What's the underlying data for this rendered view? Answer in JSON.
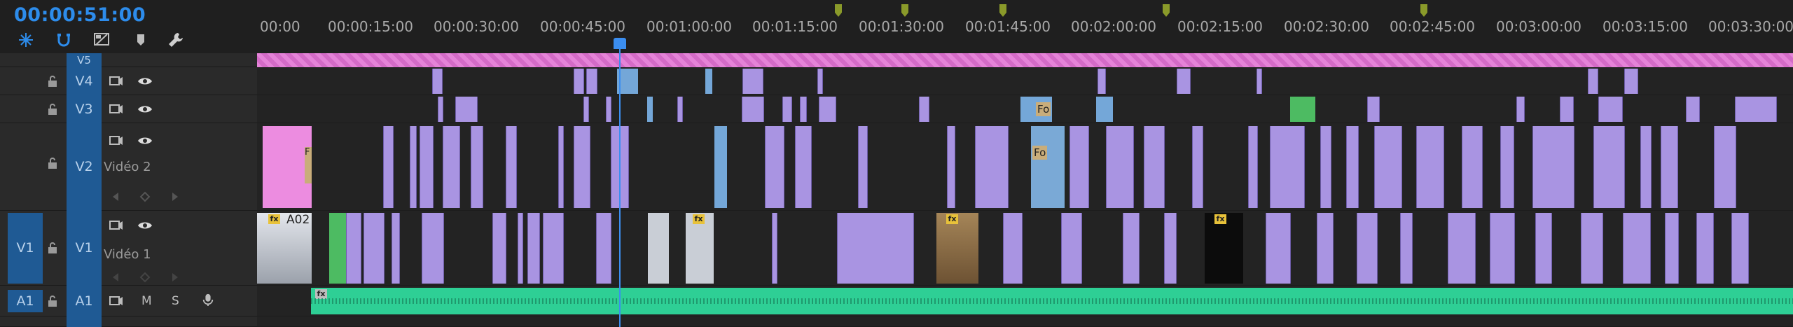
{
  "timecode": "00:00:51:00",
  "ruler": {
    "labels": [
      "00:00",
      "00:00:15:00",
      "00:00:30:00",
      "00:00:45:00",
      "00:01:00:00",
      "00:01:15:00",
      "00:01:30:00",
      "00:01:45:00",
      "00:02:00:00",
      "00:02:15:00",
      "00:02:30:00",
      "00:02:45:00",
      "00:03:00:00",
      "00:03:15:00",
      "00:03:30:00"
    ]
  },
  "tracks": {
    "v5": {
      "target": "V5"
    },
    "v4": {
      "target": "V4"
    },
    "v3": {
      "target": "V3"
    },
    "v2": {
      "target": "V2",
      "name": "Vidéo 2"
    },
    "v1": {
      "source": "V1",
      "target": "V1",
      "name": "Vidéo 1"
    },
    "a1": {
      "source": "A1",
      "target": "A1",
      "mute": "M",
      "solo": "S"
    }
  },
  "clips": {
    "a02_label": "A02",
    "fo_label_v3": "Fo",
    "fo_label_v2": "Fo",
    "fx": "fx",
    "frame_label": "F"
  },
  "colors": {
    "accent": "#2d8ceb",
    "video_clip": "#a994e2",
    "pink_clip": "#ec8ce0",
    "audio_clip": "#2ecf95",
    "green_clip": "#4dbb62",
    "blue_clip": "#74a7d8"
  }
}
